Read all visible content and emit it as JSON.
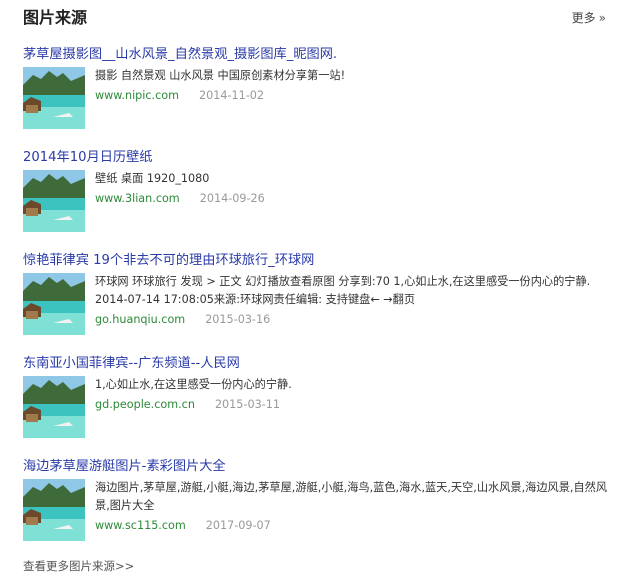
{
  "header": {
    "title": "图片来源",
    "more_label": "更多",
    "more_icon": "double-chevron-right-icon"
  },
  "results": [
    {
      "title": "茅草屋摄影图__山水风景_自然景观_摄影图库_昵图网.",
      "desc": "摄影 自然景观 山水风景 中国原创素材分享第一站!",
      "url": "www.nipic.com",
      "date": "2014-11-02"
    },
    {
      "title": "2014年10月日历壁纸",
      "desc": "壁纸 桌面 1920_1080",
      "url": "www.3lian.com",
      "date": "2014-09-26"
    },
    {
      "title": "惊艳菲律宾 19个非去不可的理由环球旅行_环球网",
      "desc": "环球网 环球旅行 发现 > 正文 幻灯播放查看原图 分享到:70 1,心如止水,在这里感受一份内心的宁静. 2014-07-14 17:08:05来源:环球网责任编辑: 支持键盘← →翻页",
      "url": "go.huanqiu.com",
      "date": "2015-03-16"
    },
    {
      "title": "东南亚小国菲律宾--广东频道--人民网",
      "desc": "1,心如止水,在这里感受一份内心的宁静.",
      "url": "gd.people.com.cn",
      "date": "2015-03-11"
    },
    {
      "title": "海边茅草屋游艇图片-素彩图片大全",
      "desc": "海边图片,茅草屋,游艇,小艇,海边,茅草屋,游艇,小艇,海鸟,蓝色,海水,蓝天,天空,山水风景,海边风景,自然风景,图片大全",
      "url": "www.sc115.com",
      "date": "2017-09-07"
    }
  ],
  "footer": {
    "more_link": "查看更多图片来源>>"
  },
  "colors": {
    "title_link": "#2a3ba8",
    "url": "#2c8a38",
    "date": "#999999"
  }
}
